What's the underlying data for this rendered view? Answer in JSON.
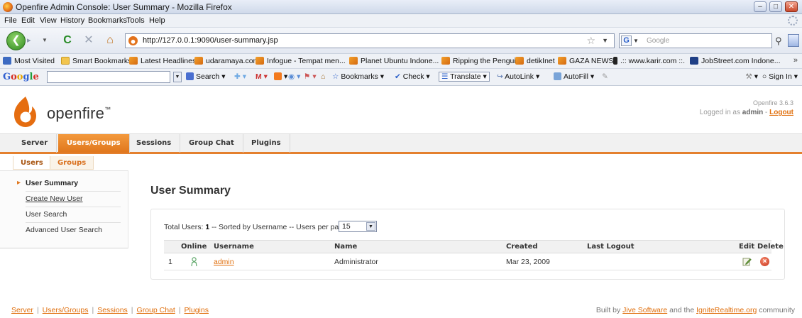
{
  "window": {
    "title": "Openfire Admin Console: User Summary - Mozilla Firefox",
    "minimize": "–",
    "maximize": "□",
    "close": "✕"
  },
  "menu": [
    "File",
    "Edit",
    "View",
    "History",
    "Bookmarks",
    "Tools",
    "Help"
  ],
  "nav": {
    "back_glyph": "❮",
    "forward_glyph": "▸",
    "reload_glyph": "C",
    "stop_glyph": "✕",
    "home_glyph": "⌂",
    "url": "http://127.0.0.1:9090/user-summary.jsp",
    "search_engine_letter": "G",
    "search_placeholder": "Google"
  },
  "bookmarks": [
    {
      "label": "Most Visited",
      "icon": "rss"
    },
    {
      "label": "Smart Bookmarks",
      "icon": "folder"
    },
    {
      "label": "Latest Headlines",
      "icon": "feed"
    },
    {
      "label": "udaramaya.com",
      "icon": "feed"
    },
    {
      "label": "Infogue - Tempat men...",
      "icon": "feed"
    },
    {
      "label": "Planet Ubuntu Indone...",
      "icon": "feed"
    },
    {
      "label": "Ripping the Penguin",
      "icon": "feed"
    },
    {
      "label": "detikInet",
      "icon": "feed"
    },
    {
      "label": "GAZA NEWS",
      "icon": "feed"
    },
    {
      "label": ".:: www.karir.com ::.",
      "icon": "k"
    },
    {
      "label": "JobStreet.com Indone...",
      "icon": "j"
    }
  ],
  "google_toolbar": {
    "logo": [
      "G",
      "o",
      "o",
      "g",
      "l",
      "e"
    ],
    "items": [
      "Search",
      "Bookmarks",
      "Check",
      "Translate",
      "AutoLink",
      "AutoFill"
    ],
    "sign_in": "Sign In"
  },
  "openfire": {
    "brand": "openfire",
    "trademark": "™",
    "version": "Openfire 3.6.3",
    "logged_in_prefix": "Logged in as",
    "logged_in_user": "admin",
    "logout": "Logout",
    "main_tabs": [
      "Server",
      "Users/Groups",
      "Sessions",
      "Group Chat",
      "Plugins"
    ],
    "active_main_tab": "Users/Groups",
    "sub_tabs": [
      "Users",
      "Groups"
    ],
    "active_sub_tab": "Users",
    "sidebar": [
      "User Summary",
      "Create New User",
      "User Search",
      "Advanced User Search"
    ],
    "active_sidebar": "User Summary",
    "page_title": "User Summary",
    "summary": {
      "total_label": "Total Users:",
      "total_value": "1",
      "sorted_text": "-- Sorted by Username -- Users per page:",
      "per_page": "15"
    },
    "table": {
      "columns": [
        "Online",
        "Username",
        "Name",
        "Created",
        "Last Logout",
        "Edit",
        "Delete"
      ],
      "rows": [
        {
          "index": "1",
          "username": "admin",
          "name": "Administrator",
          "created": "Mar 23, 2009",
          "last_logout": ""
        }
      ]
    },
    "footer": {
      "links": [
        "Server",
        "Users/Groups",
        "Sessions",
        "Group Chat",
        "Plugins"
      ],
      "credit_prefix": "Built by",
      "credit_link1": "Jive Software",
      "credit_middle": "and the",
      "credit_link2": "IgniteRealtime.org",
      "credit_suffix": "community"
    }
  },
  "colors": {
    "accent_orange": "#e0761c",
    "link_orange": "#e06f0d"
  }
}
